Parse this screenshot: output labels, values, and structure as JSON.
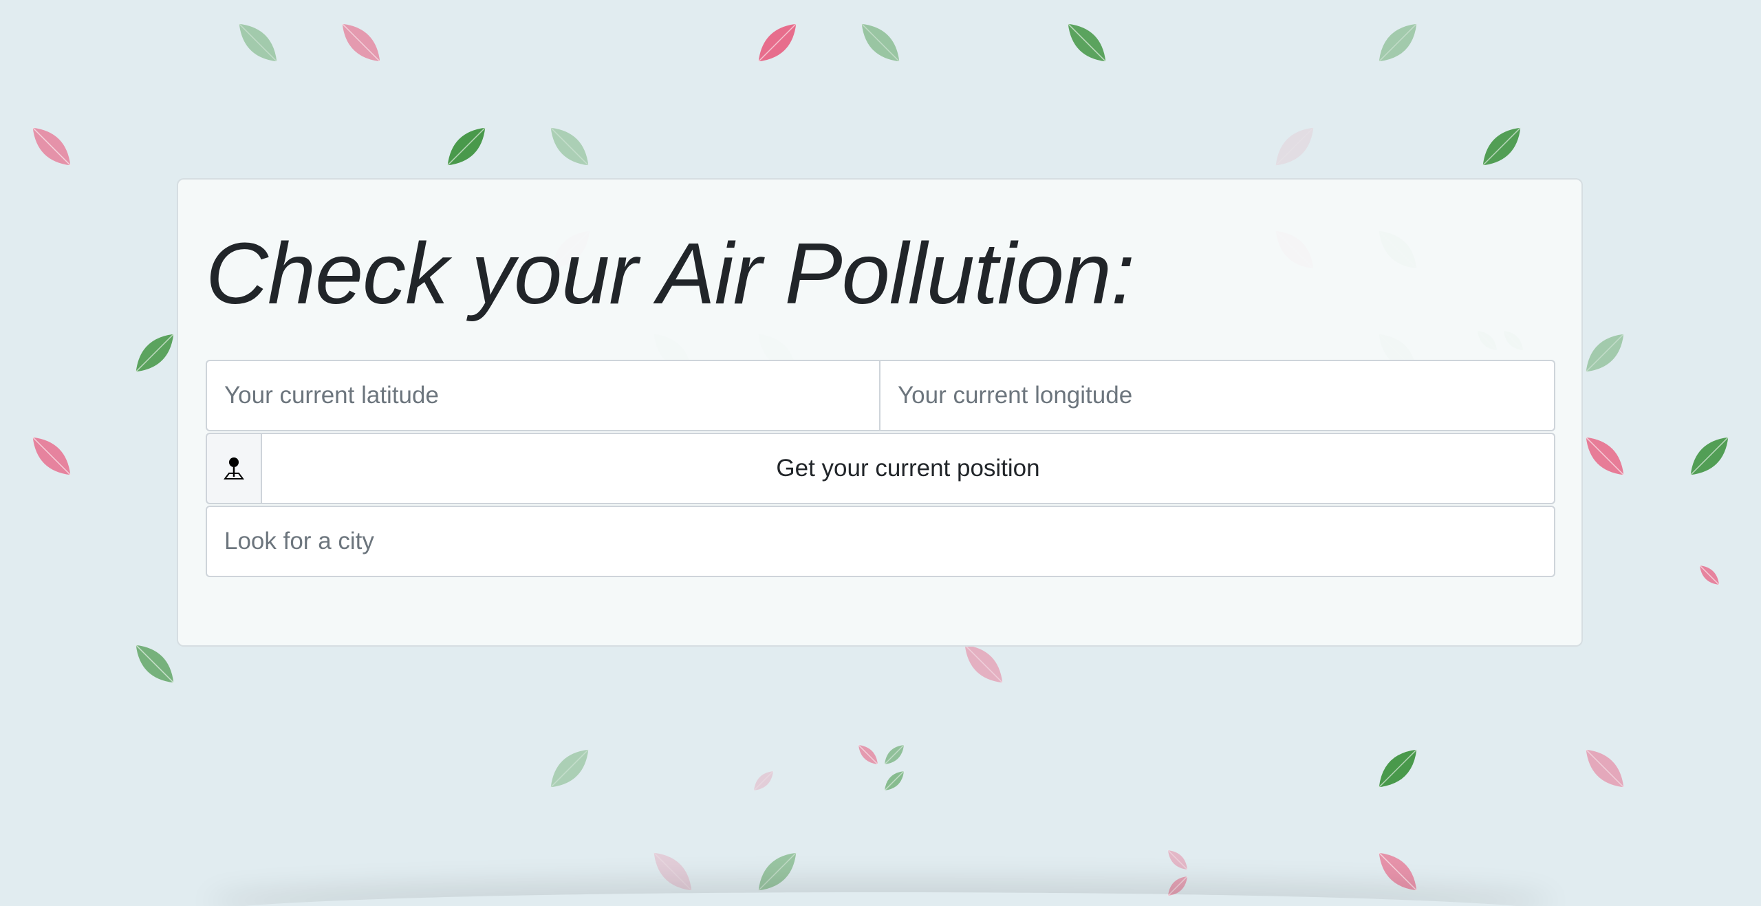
{
  "page": {
    "title": "Check your Air Pollution:"
  },
  "form": {
    "latitude_placeholder": "Your current latitude",
    "longitude_placeholder": "Your current longitude",
    "position_button_label": "Get your current position",
    "position_icon": "map-pin-icon",
    "city_placeholder": "Look for a city"
  },
  "colors": {
    "background": "#e1ecf0",
    "leaf_pink": "#e8577a",
    "leaf_green": "#2e8b2e",
    "text": "#212529",
    "placeholder": "#6c757d"
  }
}
